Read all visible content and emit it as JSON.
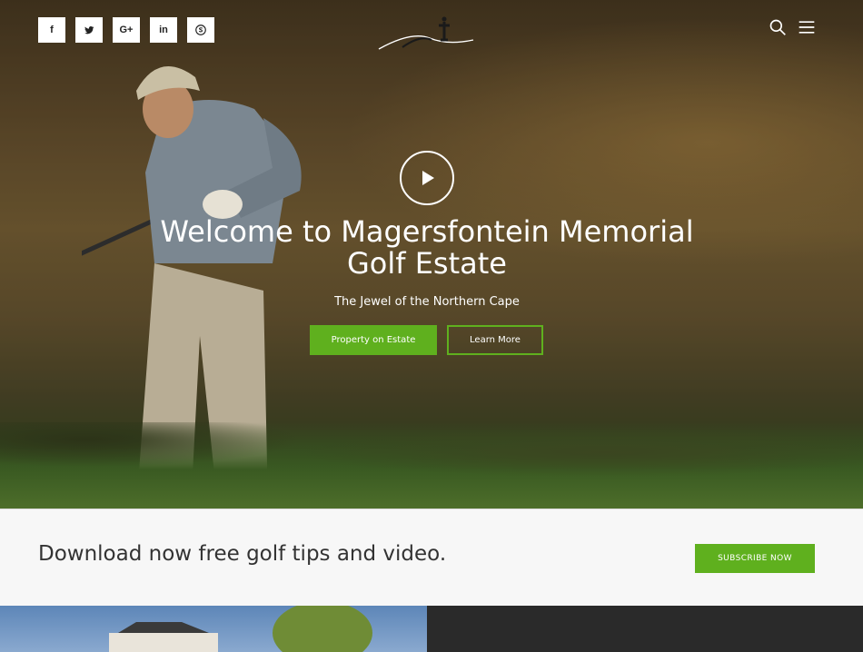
{
  "social": [
    {
      "label": "f",
      "icon": "facebook-icon"
    },
    {
      "label": "♥",
      "icon": "twitter-icon"
    },
    {
      "label": "G+",
      "icon": "google-plus-icon"
    },
    {
      "label": "in",
      "icon": "linkedin-icon"
    },
    {
      "label": "S",
      "icon": "skype-icon"
    }
  ],
  "hero": {
    "title": "Welcome to Magersfontein Memorial Golf Estate",
    "subtitle": "The Jewel of the Northern Cape",
    "primary_button": "Property on Estate",
    "secondary_button": "Learn More"
  },
  "cta": {
    "text": "Download now free golf tips and video.",
    "button": "SUBSCRIBE NOW"
  },
  "colors": {
    "accent": "#5fb01e",
    "dark_panel": "#2a2a2a",
    "cta_background": "#f7f7f7"
  }
}
